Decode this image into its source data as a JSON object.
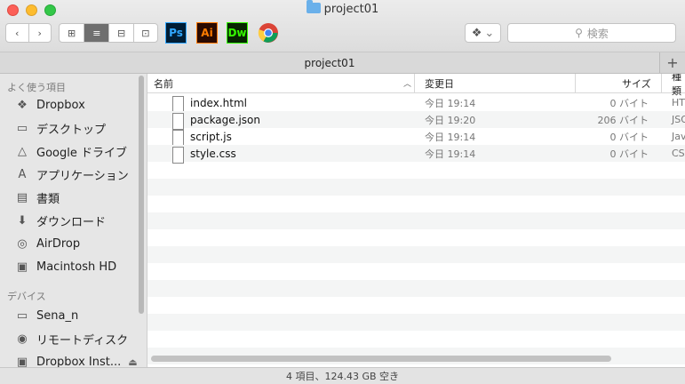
{
  "window": {
    "title": "project01"
  },
  "toolbar": {
    "back": "‹",
    "forward": "›",
    "view_icons": "⊞",
    "view_list": "≡",
    "view_columns": "⊟",
    "view_gallery": "⊡",
    "apps": [
      {
        "label": "Ps",
        "bg": "#001d34",
        "fg": "#31a8ff"
      },
      {
        "label": "Ai",
        "bg": "#2a0a00",
        "fg": "#ff7c00"
      },
      {
        "label": "Dw",
        "bg": "#072401",
        "fg": "#35fa00"
      }
    ],
    "dropbox_menu": "⌄",
    "search_placeholder": "検索"
  },
  "tab": {
    "label": "project01",
    "plus": "+"
  },
  "sidebar": {
    "favorites_heading": "よく使う項目",
    "favorites": [
      {
        "label": "Dropbox",
        "icon": "dropbox-icon",
        "glyph": "❖"
      },
      {
        "label": "デスクトップ",
        "icon": "desktop-icon",
        "glyph": "▭"
      },
      {
        "label": "Google ドライブ",
        "icon": "google-drive-icon",
        "glyph": "△"
      },
      {
        "label": "アプリケーション",
        "icon": "applications-icon",
        "glyph": "A"
      },
      {
        "label": "書類",
        "icon": "documents-icon",
        "glyph": "▤"
      },
      {
        "label": "ダウンロード",
        "icon": "downloads-icon",
        "glyph": "⬇"
      },
      {
        "label": "AirDrop",
        "icon": "airdrop-icon",
        "glyph": "◎"
      },
      {
        "label": "Macintosh HD",
        "icon": "hard-drive-icon",
        "glyph": "▣"
      }
    ],
    "devices_heading": "デバイス",
    "devices": [
      {
        "label": "Sena_n",
        "icon": "laptop-icon",
        "glyph": "▭"
      },
      {
        "label": "リモートディスク",
        "icon": "remote-disc-icon",
        "glyph": "◉"
      },
      {
        "label": "Dropbox Inst...",
        "icon": "disk-image-icon",
        "glyph": "▣",
        "eject": "⏏"
      }
    ]
  },
  "columns": {
    "name": "名前",
    "date": "変更日",
    "size": "サイズ",
    "kind": "種類"
  },
  "files": [
    {
      "name": "index.html",
      "date": "今日 19:14",
      "size": "0 バイト",
      "kind": "HTML",
      "icon": "html-file-icon"
    },
    {
      "name": "package.json",
      "date": "今日 19:20",
      "size": "206 バイト",
      "kind": "JSON",
      "icon": "json-file-icon"
    },
    {
      "name": "script.js",
      "date": "今日 19:14",
      "size": "0 バイト",
      "kind": "JavaScript",
      "icon": "js-file-icon"
    },
    {
      "name": "style.css",
      "date": "今日 19:14",
      "size": "0 バイト",
      "kind": "CSS",
      "icon": "css-file-icon"
    }
  ],
  "status": {
    "text": "4 項目、124.43 GB 空き"
  }
}
